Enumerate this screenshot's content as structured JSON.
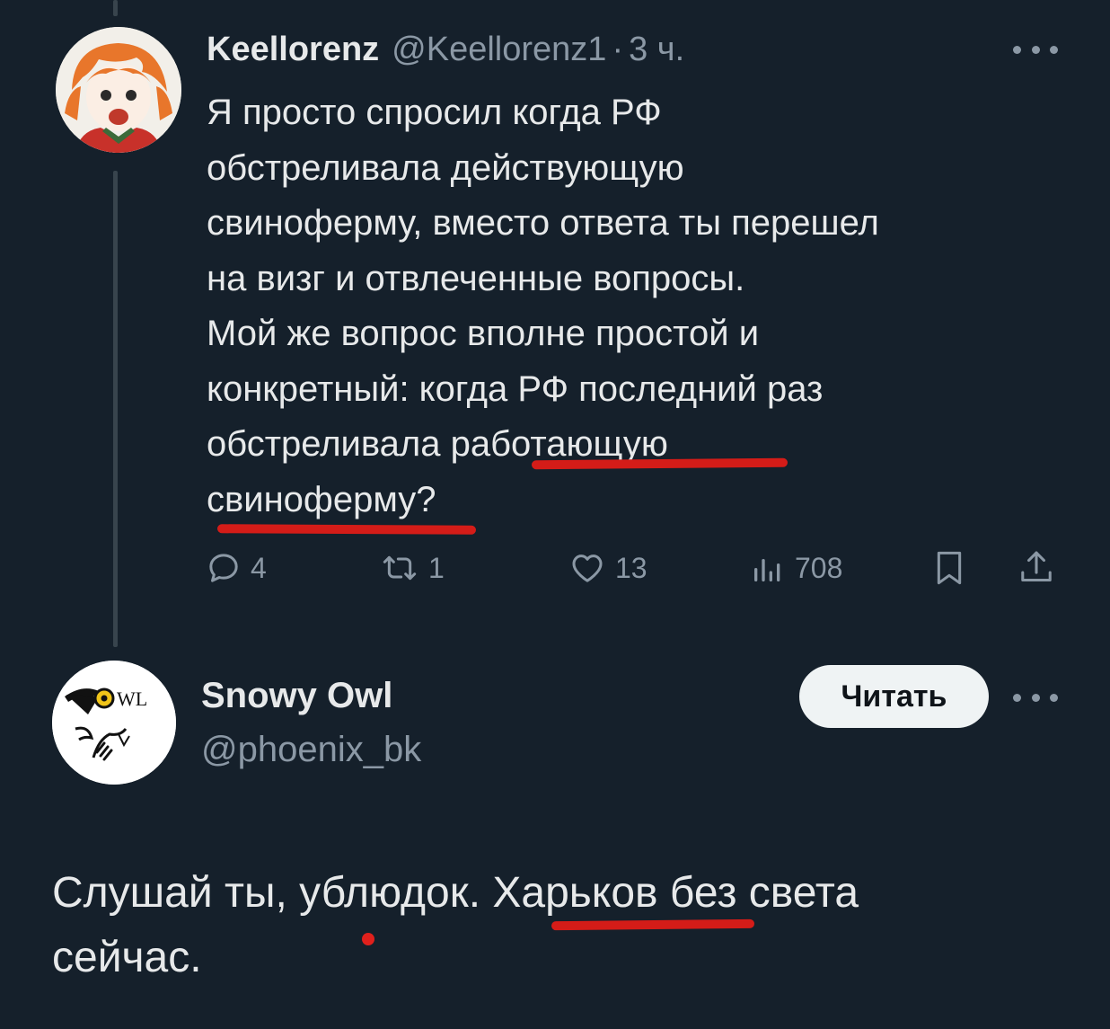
{
  "tweet": {
    "display_name": "Keellorenz",
    "handle": "@Keellorenz1",
    "separator": "·",
    "time": "3 ч.",
    "text_lines": [
      "Я просто спросил когда РФ",
      "обстреливала действующую",
      "свиноферму, вместо ответа ты перешел",
      "на визг и отвлеченные вопросы.",
      "Мой же вопрос вполне простой и",
      "конкретный: когда РФ последний раз",
      "обстреливала работающую",
      "свиноферму?"
    ],
    "avatar_icon": "anime-avatar-icon",
    "stats": {
      "replies": "4",
      "reposts": "1",
      "likes": "13",
      "views": "708"
    }
  },
  "reply": {
    "display_name": "Snowy Owl",
    "handle": "@phoenix_bk",
    "follow_label": "Читать",
    "avatar_icon": "owl-logo-icon",
    "avatar_logo_text": "WL",
    "text_lines": [
      "Слушай ты, ублюдок. Харьков без света",
      "сейчас."
    ]
  },
  "colors": {
    "background": "#15202b",
    "text": "#e7e9ea",
    "muted": "#8b98a5",
    "annotation_red": "#d41c18",
    "follow_button_bg": "#eff3f4"
  }
}
